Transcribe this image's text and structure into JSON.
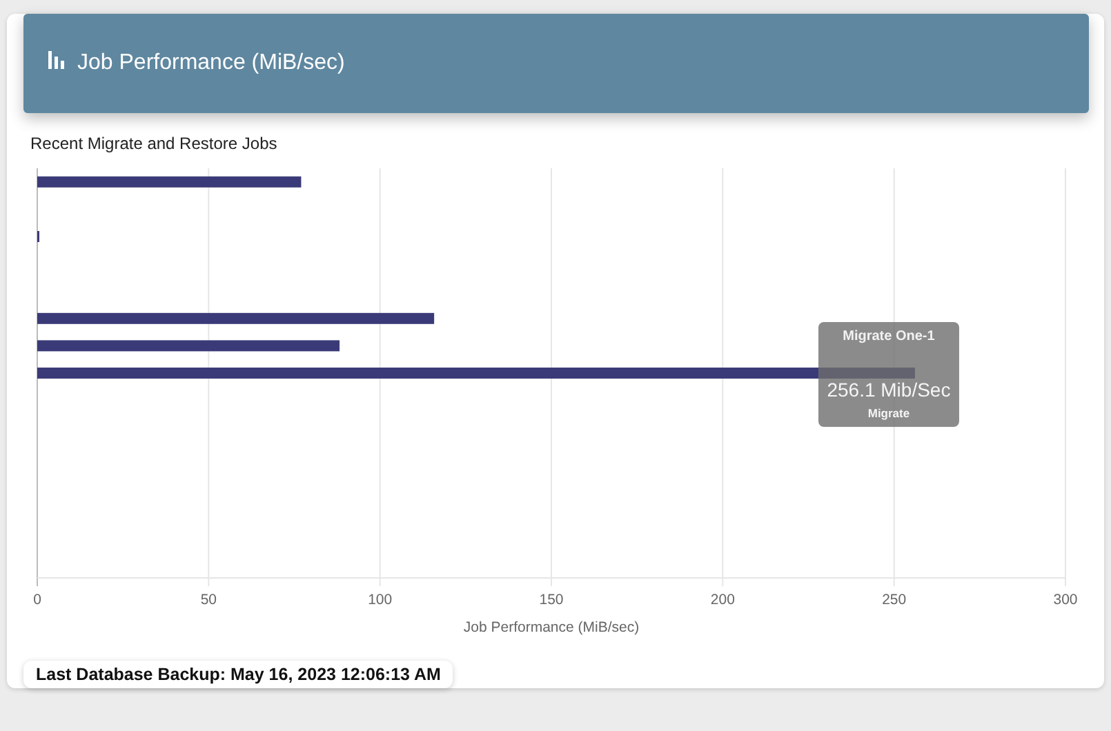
{
  "header": {
    "title": "Job Performance (MiB/sec)"
  },
  "chart": {
    "subtitle": "Recent Migrate and Restore Jobs",
    "chart_data": {
      "type": "bar",
      "orientation": "horizontal",
      "xlabel": "Job Performance (MiB/sec)",
      "xlim": [
        0,
        300
      ],
      "xticks": [
        0,
        50,
        100,
        150,
        200,
        250,
        300
      ],
      "grid": true,
      "series": [
        {
          "color": "#3b3a78",
          "values": [
            77,
            null,
            0.5,
            null,
            null,
            115.8,
            88.2,
            256.1,
            null,
            null,
            null,
            null,
            null,
            null,
            null
          ]
        }
      ]
    },
    "tooltip": {
      "title": "Migrate One-1",
      "value": "256.1 Mib/Sec",
      "subtitle": "Migrate"
    }
  },
  "footer": {
    "text": "Last Database Backup: May 16, 2023 12:06:13 AM"
  }
}
